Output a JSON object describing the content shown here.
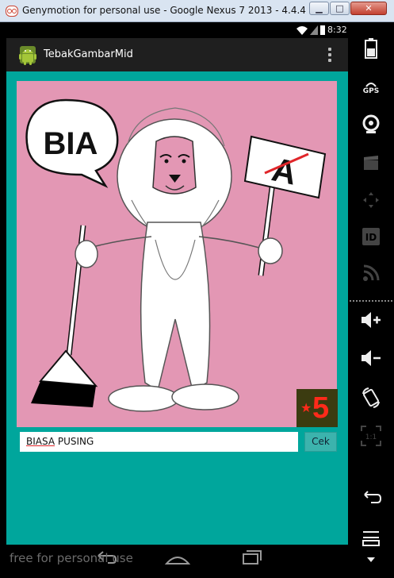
{
  "window": {
    "title": "Genymotion for personal use - Google Nexus 7 2013 - 4.4.4 - API..."
  },
  "statusbar": {
    "time": "8:32"
  },
  "app": {
    "title": "TebakGambarMid"
  },
  "puzzle": {
    "speech_bubble": "BIA",
    "sign_letter": "A",
    "stars": "5"
  },
  "answer": {
    "word1": "BIASA",
    "word2": "PUSING"
  },
  "buttons": {
    "check": "Cek"
  },
  "watermark": "free for personal use",
  "colors": {
    "accent": "#00a69c",
    "card": "#e397b4",
    "star": "#ff2a1a"
  }
}
